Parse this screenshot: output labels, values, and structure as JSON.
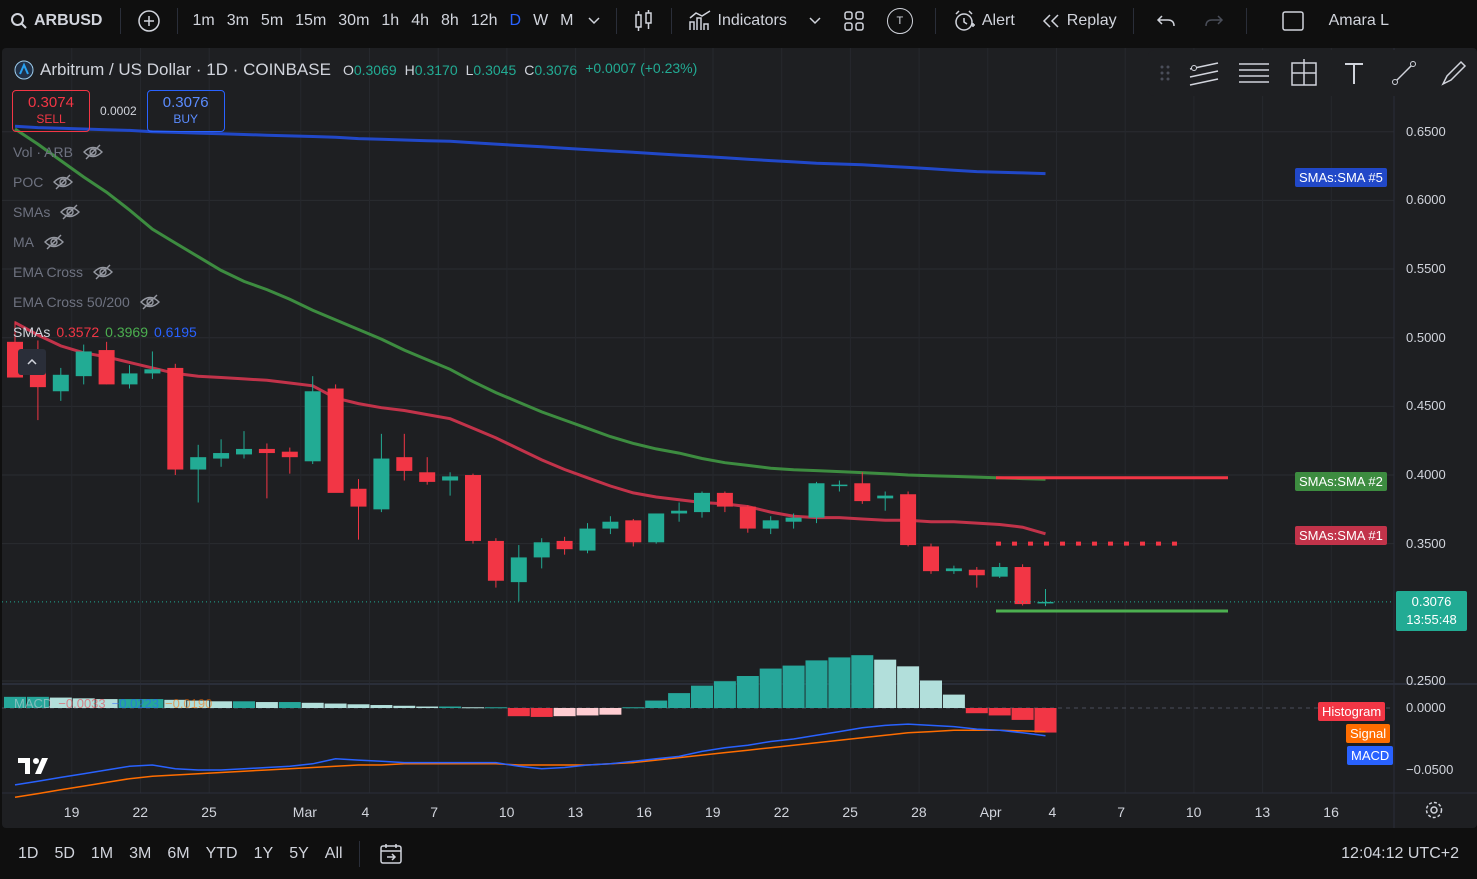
{
  "toolbar": {
    "symbol": "ARBUSD",
    "timeframes": [
      "1m",
      "3m",
      "5m",
      "15m",
      "30m",
      "1h",
      "4h",
      "8h",
      "12h",
      "D",
      "W",
      "M"
    ],
    "active_timeframe": "D",
    "indicators_label": "Indicators",
    "alert_label": "Alert",
    "replay_label": "Replay",
    "user_name": "Amara L",
    "templates_badge": "T"
  },
  "legend": {
    "title": "Arbitrum / US Dollar · 1D · COINBASE",
    "open_key": "O",
    "open": "0.3069",
    "high_key": "H",
    "high": "0.3170",
    "low_key": "L",
    "low": "0.3045",
    "close_key": "C",
    "close": "0.3076",
    "change": "+0.0007 (+0.23%)"
  },
  "trade": {
    "sell_price": "0.3074",
    "sell_label": "SELL",
    "spread": "0.0002",
    "buy_price": "0.3076",
    "buy_label": "BUY"
  },
  "indicators": [
    {
      "label": "Vol · ARB"
    },
    {
      "label": "POC"
    },
    {
      "label": "SMAs"
    },
    {
      "label": "MA"
    },
    {
      "label": "EMA Cross"
    },
    {
      "label": "EMA Cross 50/200"
    }
  ],
  "smas_legend": {
    "label": "SMAs",
    "v1": "0.3572",
    "v2": "0.3969",
    "v3": "0.6195"
  },
  "macd_legend": {
    "label": "MACD",
    "v1": "−0.0033",
    "v2": "−0.0223",
    "v3": "−0.0190"
  },
  "price_axis": {
    "ticks": [
      "0.6500",
      "0.6000",
      "0.5500",
      "0.5000",
      "0.4500",
      "0.4000",
      "0.3500",
      "0.2500"
    ],
    "current_price": "0.3076",
    "countdown": "13:55:48"
  },
  "series_tags": {
    "sma5": "SMAs:SMA #5",
    "sma2": "SMAs:SMA #2",
    "sma1": "SMAs:SMA #1"
  },
  "macd_axis": {
    "ticks": [
      "0.0000",
      "−0.0500"
    ],
    "histogram": "Histogram",
    "signal": "Signal",
    "macd": "MACD"
  },
  "time_axis": [
    "19",
    "22",
    "25",
    "Mar",
    "4",
    "7",
    "10",
    "13",
    "16",
    "19",
    "22",
    "25",
    "28",
    "Apr",
    "4",
    "7",
    "10",
    "13",
    "16"
  ],
  "ranges": [
    "1D",
    "5D",
    "1M",
    "3M",
    "6M",
    "YTD",
    "1Y",
    "5Y",
    "All"
  ],
  "clock": "12:04:12 UTC+2",
  "colors": {
    "up": "#22ab94",
    "down": "#f23645",
    "sma_blue": "#2148c8",
    "sma_green": "#3d8c40",
    "sma_red": "#c2334a",
    "level_red": "#f23645",
    "level_green": "#4caf50"
  },
  "chart_data": {
    "type": "candlestick",
    "dates": [
      "Feb 17",
      "Feb 18",
      "Feb 19",
      "Feb 20",
      "Feb 21",
      "Feb 22",
      "Feb 23",
      "Feb 24",
      "Feb 25",
      "Feb 26",
      "Feb 27",
      "Feb 28",
      "Feb 29",
      "Mar 1",
      "Mar 2",
      "Mar 3",
      "Mar 4",
      "Mar 5",
      "Mar 6",
      "Mar 7",
      "Mar 8",
      "Mar 9",
      "Mar 10",
      "Mar 11",
      "Mar 12",
      "Mar 13",
      "Mar 14",
      "Mar 15",
      "Mar 16",
      "Mar 17",
      "Mar 18",
      "Mar 19",
      "Mar 20",
      "Mar 21",
      "Mar 22",
      "Mar 23",
      "Mar 24",
      "Mar 25",
      "Mar 26",
      "Mar 27",
      "Mar 28",
      "Mar 29",
      "Mar 30",
      "Mar 31",
      "Apr 1",
      "Apr 2"
    ],
    "ohlc": [
      [
        0.497,
        0.512,
        0.472,
        0.471
      ],
      [
        0.488,
        0.498,
        0.44,
        0.464
      ],
      [
        0.461,
        0.478,
        0.454,
        0.473
      ],
      [
        0.472,
        0.495,
        0.466,
        0.49
      ],
      [
        0.491,
        0.497,
        0.466,
        0.466
      ],
      [
        0.466,
        0.48,
        0.463,
        0.474
      ],
      [
        0.474,
        0.49,
        0.47,
        0.477
      ],
      [
        0.478,
        0.481,
        0.4,
        0.404
      ],
      [
        0.404,
        0.422,
        0.38,
        0.413
      ],
      [
        0.412,
        0.426,
        0.406,
        0.416
      ],
      [
        0.415,
        0.432,
        0.412,
        0.419
      ],
      [
        0.419,
        0.423,
        0.383,
        0.416
      ],
      [
        0.417,
        0.42,
        0.401,
        0.413
      ],
      [
        0.41,
        0.472,
        0.408,
        0.461
      ],
      [
        0.463,
        0.466,
        0.388,
        0.387
      ],
      [
        0.39,
        0.397,
        0.353,
        0.377
      ],
      [
        0.375,
        0.43,
        0.373,
        0.412
      ],
      [
        0.413,
        0.43,
        0.396,
        0.403
      ],
      [
        0.402,
        0.413,
        0.393,
        0.395
      ],
      [
        0.396,
        0.402,
        0.385,
        0.399
      ],
      [
        0.4,
        0.401,
        0.35,
        0.352
      ],
      [
        0.352,
        0.354,
        0.318,
        0.323
      ],
      [
        0.322,
        0.349,
        0.308,
        0.34
      ],
      [
        0.34,
        0.354,
        0.332,
        0.351
      ],
      [
        0.352,
        0.355,
        0.342,
        0.346
      ],
      [
        0.345,
        0.365,
        0.343,
        0.361
      ],
      [
        0.361,
        0.37,
        0.357,
        0.366
      ],
      [
        0.367,
        0.368,
        0.348,
        0.351
      ],
      [
        0.351,
        0.372,
        0.35,
        0.372
      ],
      [
        0.372,
        0.38,
        0.366,
        0.374
      ],
      [
        0.373,
        0.388,
        0.369,
        0.387
      ],
      [
        0.387,
        0.388,
        0.373,
        0.377
      ],
      [
        0.377,
        0.378,
        0.358,
        0.361
      ],
      [
        0.361,
        0.37,
        0.357,
        0.367
      ],
      [
        0.366,
        0.372,
        0.361,
        0.369
      ],
      [
        0.369,
        0.395,
        0.365,
        0.394
      ],
      [
        0.392,
        0.396,
        0.388,
        0.393
      ],
      [
        0.394,
        0.402,
        0.379,
        0.381
      ],
      [
        0.383,
        0.388,
        0.374,
        0.385
      ],
      [
        0.386,
        0.388,
        0.348,
        0.349
      ],
      [
        0.348,
        0.35,
        0.328,
        0.33
      ],
      [
        0.33,
        0.334,
        0.328,
        0.332
      ],
      [
        0.331,
        0.333,
        0.318,
        0.327
      ],
      [
        0.326,
        0.336,
        0.325,
        0.333
      ],
      [
        0.333,
        0.335,
        0.305,
        0.306
      ],
      [
        0.3069,
        0.317,
        0.3045,
        0.3076
      ]
    ],
    "sma1": [
      0.511,
      0.502,
      0.494,
      0.489,
      0.486,
      0.482,
      0.478,
      0.474,
      0.472,
      0.471,
      0.47,
      0.469,
      0.467,
      0.465,
      0.456,
      0.452,
      0.449,
      0.447,
      0.444,
      0.441,
      0.434,
      0.427,
      0.419,
      0.411,
      0.404,
      0.398,
      0.392,
      0.387,
      0.384,
      0.382,
      0.38,
      0.379,
      0.377,
      0.373,
      0.37,
      0.369,
      0.369,
      0.368,
      0.367,
      0.367,
      0.366,
      0.366,
      0.365,
      0.364,
      0.362,
      0.3572
    ],
    "sma2": [
      0.652,
      0.641,
      0.629,
      0.617,
      0.606,
      0.593,
      0.579,
      0.569,
      0.559,
      0.549,
      0.541,
      0.535,
      0.528,
      0.52,
      0.513,
      0.506,
      0.499,
      0.491,
      0.484,
      0.477,
      0.468,
      0.46,
      0.453,
      0.446,
      0.44,
      0.434,
      0.428,
      0.423,
      0.419,
      0.416,
      0.412,
      0.409,
      0.407,
      0.405,
      0.4038,
      0.4032,
      0.4025,
      0.4018,
      0.401,
      0.4,
      0.3995,
      0.399,
      0.3985,
      0.3979,
      0.3974,
      0.3969
    ],
    "sma5": [
      0.654,
      0.653,
      0.6525,
      0.652,
      0.6515,
      0.651,
      0.65,
      0.6495,
      0.649,
      0.6485,
      0.648,
      0.6475,
      0.647,
      0.6465,
      0.646,
      0.645,
      0.6445,
      0.644,
      0.6435,
      0.643,
      0.642,
      0.641,
      0.64,
      0.639,
      0.638,
      0.637,
      0.636,
      0.635,
      0.634,
      0.633,
      0.632,
      0.631,
      0.63,
      0.629,
      0.628,
      0.627,
      0.6265,
      0.626,
      0.625,
      0.624,
      0.623,
      0.622,
      0.621,
      0.6205,
      0.62,
      0.6195
    ],
    "levels": {
      "resistance_red": 0.398,
      "dotted_red": 0.35,
      "support_green": 0.301
    },
    "macd_hist": [
      0.0015,
      0.0015,
      0.0014,
      0.0013,
      0.0012,
      0.0012,
      0.0012,
      0.0011,
      0.001,
      0.0009,
      0.0009,
      0.0008,
      0.0008,
      0.0007,
      0.0006,
      0.0005,
      0.0004,
      0.0003,
      0.0002,
      0.0002,
      0.0001,
      0.0001,
      -0.0011,
      -0.0012,
      -0.0011,
      -0.001,
      -0.0009,
      0.0001,
      0.001,
      0.002,
      0.003,
      0.0036,
      0.0043,
      0.0053,
      0.0057,
      0.0064,
      0.0068,
      0.0071,
      0.0065,
      0.0056,
      0.0037,
      0.0018,
      -0.0007,
      -0.001,
      -0.0016,
      -0.0033
    ],
    "macd_line": [
      -0.062,
      -0.059,
      -0.056,
      -0.053,
      -0.05,
      -0.047,
      -0.046,
      -0.049,
      -0.05,
      -0.05,
      -0.049,
      -0.048,
      -0.047,
      -0.045,
      -0.041,
      -0.042,
      -0.043,
      -0.044,
      -0.044,
      -0.044,
      -0.044,
      -0.044,
      -0.047,
      -0.049,
      -0.048,
      -0.046,
      -0.045,
      -0.043,
      -0.041,
      -0.039,
      -0.035,
      -0.032,
      -0.03,
      -0.027,
      -0.025,
      -0.022,
      -0.019,
      -0.016,
      -0.014,
      -0.013,
      -0.014,
      -0.015,
      -0.017,
      -0.018,
      -0.02,
      -0.0223
    ],
    "macd_signal": [
      -0.072,
      -0.069,
      -0.066,
      -0.063,
      -0.06,
      -0.057,
      -0.055,
      -0.054,
      -0.053,
      -0.052,
      -0.051,
      -0.05,
      -0.049,
      -0.048,
      -0.047,
      -0.046,
      -0.046,
      -0.045,
      -0.045,
      -0.045,
      -0.045,
      -0.045,
      -0.046,
      -0.046,
      -0.046,
      -0.046,
      -0.045,
      -0.044,
      -0.042,
      -0.04,
      -0.038,
      -0.036,
      -0.034,
      -0.032,
      -0.03,
      -0.028,
      -0.026,
      -0.024,
      -0.022,
      -0.02,
      -0.019,
      -0.018,
      -0.018,
      -0.018,
      -0.0185,
      -0.019
    ],
    "ylim": [
      0.25,
      0.66
    ]
  }
}
